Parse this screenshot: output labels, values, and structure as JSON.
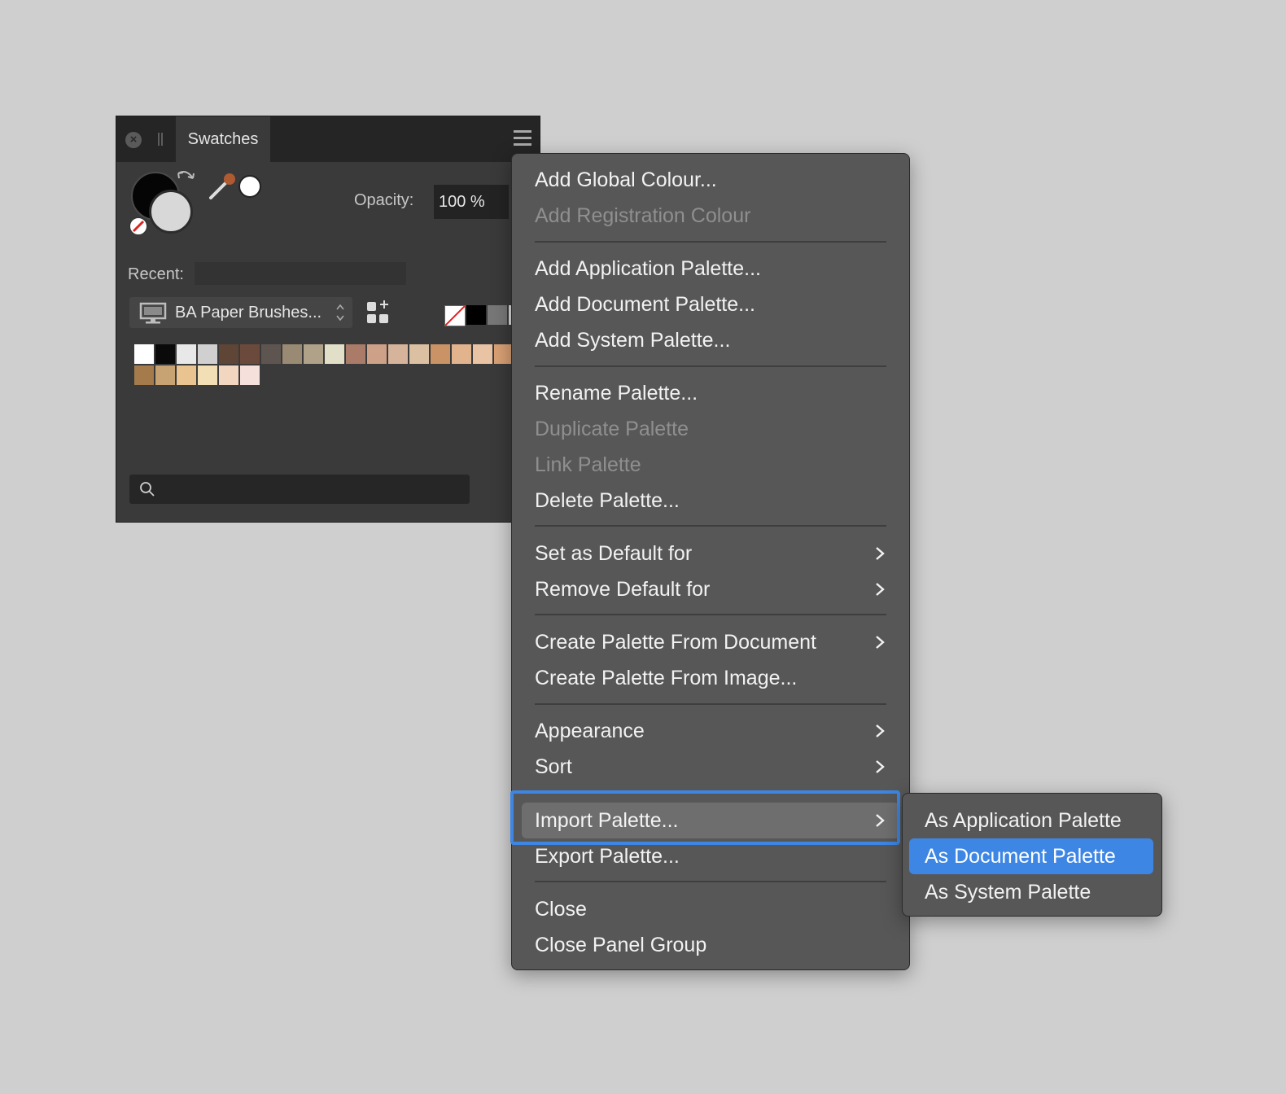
{
  "panel": {
    "tab_label": "Swatches",
    "opacity_label": "Opacity:",
    "opacity_value": "100 %",
    "recent_label": "Recent:",
    "palette_name": "BA Paper Brushes...",
    "swatches": [
      "#ffffff",
      "#0a0a0a",
      "#e8e8e8",
      "#d0d0d0",
      "#5e4536",
      "#6b4a3b",
      "#5f5550",
      "#9b8a73",
      "#b0a288",
      "#e2dfc8",
      "#a97b68",
      "#cda088",
      "#d6b49b",
      "#dcc0a2",
      "#c99366",
      "#e2b48e",
      "#e8c4a4",
      "#d9a074",
      "#a57b4c",
      "#c7a374",
      "#e9c390",
      "#f3dfb6",
      "#f3d6bf",
      "#f6e0dc"
    ],
    "icons": {
      "close": "close-icon",
      "grip": "grip-icon",
      "menu": "hamburger-icon",
      "swap": "swap-arrows-icon",
      "picker": "color-picker-icon",
      "monitor": "monitor-icon",
      "updown": "up-down-chevron-icon",
      "add_swatch": "add-swatch-icon",
      "search": "search-icon"
    }
  },
  "menu": {
    "items": [
      {
        "label": "Add Global Colour..."
      },
      {
        "label": "Add Registration Colour"
      },
      {
        "label": "Add Application Palette..."
      },
      {
        "label": "Add Document Palette..."
      },
      {
        "label": "Add System Palette..."
      },
      {
        "label": "Rename Palette..."
      },
      {
        "label": "Duplicate Palette"
      },
      {
        "label": "Link Palette"
      },
      {
        "label": "Delete Palette..."
      },
      {
        "label": "Set as Default for"
      },
      {
        "label": "Remove Default for"
      },
      {
        "label": "Create Palette From Document"
      },
      {
        "label": "Create Palette From Image..."
      },
      {
        "label": "Appearance"
      },
      {
        "label": "Sort"
      },
      {
        "label": "Import Palette..."
      },
      {
        "label": "Export Palette..."
      },
      {
        "label": "Close"
      },
      {
        "label": "Close Panel Group"
      }
    ]
  },
  "submenu": {
    "items": [
      {
        "label": "As Application Palette"
      },
      {
        "label": "As Document Palette"
      },
      {
        "label": "As System Palette"
      }
    ]
  },
  "colors": {
    "accent": "#3d86e4",
    "menu_bg": "#575757",
    "panel_bg": "#3a3a3a",
    "desktop_bg": "#cfcfcf"
  }
}
